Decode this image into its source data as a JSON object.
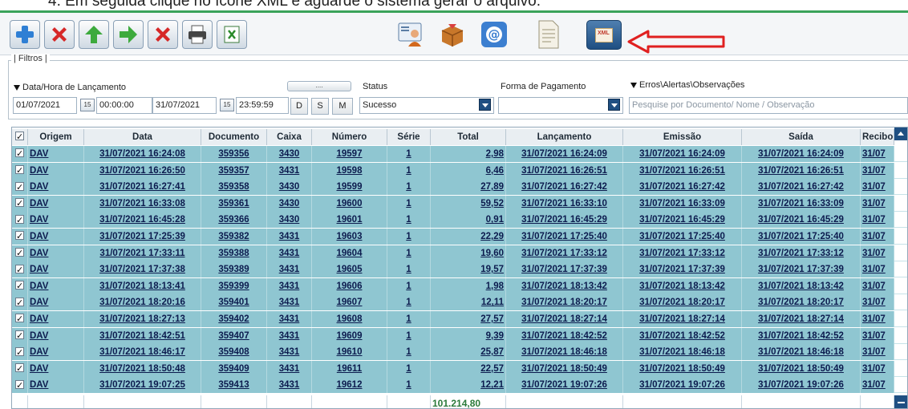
{
  "caption": "4.   Em seguida clique no ícone XML e aguarde o sistema gerar o arquivo.",
  "colors": {
    "accent_green": "#3aa35a",
    "row_teal": "#8fc6d1",
    "dark_blue": "#1f4f82",
    "arrow_red": "#e02020"
  },
  "toolbar": {
    "icons": [
      "add-icon",
      "delete-icon",
      "arrow-up-icon",
      "arrow-right-icon",
      "cancel-icon",
      "print-icon",
      "excel-icon",
      "user-card-icon",
      "package-icon",
      "email-icon",
      "document-icon",
      "xml-icon"
    ],
    "xml_label": "XML"
  },
  "filters": {
    "title": "| Filtros |",
    "date_label": "Data/Hora de Lançamento",
    "date_from": "01/07/2021",
    "time_from": "00:00:00",
    "date_to": "31/07/2021",
    "time_to": "23:59:59",
    "btn_d": "D",
    "btn_s": "S",
    "btn_m": "M",
    "dots": "....",
    "status_label": "Status",
    "status_value": "Sucesso",
    "payment_label": "Forma de Pagamento",
    "payment_value": "",
    "errors_label": "Erros\\Alertas\\Observações",
    "search_placeholder": "Pesquise por Documento/ Nome / Observação"
  },
  "table": {
    "columns": [
      "Origem",
      "Data",
      "Documento",
      "Caixa",
      "Número",
      "Série",
      "Total",
      "Lançamento",
      "Emissão",
      "Saída",
      "Recibo"
    ],
    "rows": [
      [
        "DAV",
        "31/07/2021 16:24:08",
        "359356",
        "3430",
        "19597",
        "1",
        "2,98",
        "31/07/2021 16:24:09",
        "31/07/2021 16:24:09",
        "31/07/2021 16:24:09",
        "31/07"
      ],
      [
        "DAV",
        "31/07/2021 16:26:50",
        "359357",
        "3431",
        "19598",
        "1",
        "6,46",
        "31/07/2021 16:26:51",
        "31/07/2021 16:26:51",
        "31/07/2021 16:26:51",
        "31/07"
      ],
      [
        "DAV",
        "31/07/2021 16:27:41",
        "359358",
        "3430",
        "19599",
        "1",
        "27,89",
        "31/07/2021 16:27:42",
        "31/07/2021 16:27:42",
        "31/07/2021 16:27:42",
        "31/07"
      ],
      [
        "DAV",
        "31/07/2021 16:33:08",
        "359361",
        "3430",
        "19600",
        "1",
        "59,52",
        "31/07/2021 16:33:10",
        "31/07/2021 16:33:09",
        "31/07/2021 16:33:09",
        "31/07"
      ],
      [
        "DAV",
        "31/07/2021 16:45:28",
        "359366",
        "3430",
        "19601",
        "1",
        "0,91",
        "31/07/2021 16:45:29",
        "31/07/2021 16:45:29",
        "31/07/2021 16:45:29",
        "31/07"
      ],
      [
        "DAV",
        "31/07/2021 17:25:39",
        "359382",
        "3431",
        "19603",
        "1",
        "22,29",
        "31/07/2021 17:25:40",
        "31/07/2021 17:25:40",
        "31/07/2021 17:25:40",
        "31/07"
      ],
      [
        "DAV",
        "31/07/2021 17:33:11",
        "359388",
        "3431",
        "19604",
        "1",
        "19,60",
        "31/07/2021 17:33:12",
        "31/07/2021 17:33:12",
        "31/07/2021 17:33:12",
        "31/07"
      ],
      [
        "DAV",
        "31/07/2021 17:37:38",
        "359389",
        "3431",
        "19605",
        "1",
        "19,57",
        "31/07/2021 17:37:39",
        "31/07/2021 17:37:39",
        "31/07/2021 17:37:39",
        "31/07"
      ],
      [
        "DAV",
        "31/07/2021 18:13:41",
        "359399",
        "3431",
        "19606",
        "1",
        "1,98",
        "31/07/2021 18:13:42",
        "31/07/2021 18:13:42",
        "31/07/2021 18:13:42",
        "31/07"
      ],
      [
        "DAV",
        "31/07/2021 18:20:16",
        "359401",
        "3431",
        "19607",
        "1",
        "12,11",
        "31/07/2021 18:20:17",
        "31/07/2021 18:20:17",
        "31/07/2021 18:20:17",
        "31/07"
      ],
      [
        "DAV",
        "31/07/2021 18:27:13",
        "359402",
        "3431",
        "19608",
        "1",
        "27,57",
        "31/07/2021 18:27:14",
        "31/07/2021 18:27:14",
        "31/07/2021 18:27:14",
        "31/07"
      ],
      [
        "DAV",
        "31/07/2021 18:42:51",
        "359407",
        "3431",
        "19609",
        "1",
        "9,39",
        "31/07/2021 18:42:52",
        "31/07/2021 18:42:52",
        "31/07/2021 18:42:52",
        "31/07"
      ],
      [
        "DAV",
        "31/07/2021 18:46:17",
        "359408",
        "3431",
        "19610",
        "1",
        "25,87",
        "31/07/2021 18:46:18",
        "31/07/2021 18:46:18",
        "31/07/2021 18:46:18",
        "31/07"
      ],
      [
        "DAV",
        "31/07/2021 18:50:48",
        "359409",
        "3431",
        "19611",
        "1",
        "22,57",
        "31/07/2021 18:50:49",
        "31/07/2021 18:50:49",
        "31/07/2021 18:50:49",
        "31/07"
      ],
      [
        "DAV",
        "31/07/2021 19:07:25",
        "359413",
        "3431",
        "19612",
        "1",
        "12,21",
        "31/07/2021 19:07:26",
        "31/07/2021 19:07:26",
        "31/07/2021 19:07:26",
        "31/07"
      ]
    ],
    "total_sum": "101.214,80"
  }
}
